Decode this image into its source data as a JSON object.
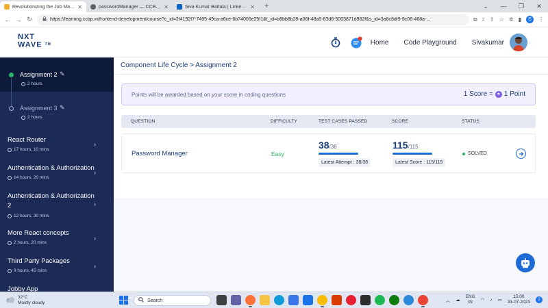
{
  "browser": {
    "tabs": [
      {
        "title": "Revolutionizing the Job Market |",
        "active": true,
        "color": "#f2b134"
      },
      {
        "title": "passwordManager — CCBP IDE",
        "active": false,
        "color": "#5f6368"
      },
      {
        "title": "Siva Kumar Battala | LinkedIn",
        "active": false,
        "color": "#0a66c2"
      }
    ],
    "new_tab": "+",
    "url": "https://learning.ccbp.in/frontend-development/course?c_id=2f4192f7-7495-49ca-a6ce-6b74005e25f1&t_id=b8bb8b28-a06f-48a5-83d6-5003871d882f&s_id=3a8c8df9-9c06-468a-...",
    "profile_initial": "S"
  },
  "header": {
    "logo_line1": "NXT",
    "logo_line2": "WAVE",
    "logo_tm": "TM",
    "nav_home": "Home",
    "nav_playground": "Code Playground",
    "user_name": "Sivakumar"
  },
  "sidebar": {
    "sub_items": [
      {
        "label": "Assignment 2",
        "time": "2 hours",
        "active": true
      },
      {
        "label": "Assignment 3",
        "time": "2 hours",
        "active": false
      }
    ],
    "items": [
      {
        "label": "React Router",
        "time": "17 hours, 10 mins"
      },
      {
        "label": "Authentication & Authorization",
        "time": "14 hours, 20 mins"
      },
      {
        "label": "Authentication & Authorization 2",
        "time": "12 hours, 30 mins"
      },
      {
        "label": "More React concepts",
        "time": "2 hours, 20 mins"
      },
      {
        "label": "Third Party Packages",
        "time": "9 hours, 45 mins"
      },
      {
        "label": "Jobby App",
        "time": ""
      }
    ]
  },
  "main": {
    "breadcrumb": "Component Life Cycle > Assignment 2",
    "notice": "Points will be awarded based on your score in coding questions",
    "score_prefix": "1 Score =",
    "score_suffix": "1 Point",
    "columns": {
      "question": "QUESTION",
      "difficulty": "DIFFICULTY",
      "test_cases": "TEST CASES PASSED",
      "score": "SCORE",
      "status": "STATUS"
    },
    "row": {
      "question": "Password Manager",
      "difficulty": "Easy",
      "tests_passed": "38",
      "tests_total": "/38",
      "latest_attempt": "Latest Attempt : 38/38",
      "score": "115",
      "score_total": "/115",
      "latest_score": "Latest Score : 115/115",
      "status": "SOLVED"
    }
  },
  "taskbar": {
    "temp": "32°C",
    "weather": "Mostly cloudy",
    "search": "Search",
    "lang1": "ENG",
    "lang2": "IN",
    "time": "15:00",
    "date": "31-07-2023",
    "notif_count": "2"
  },
  "colors": {
    "brand_navy": "#183b75",
    "sidebar_bg": "#1b2b55",
    "accent_blue": "#1f6bd6",
    "success_green": "#27b36a",
    "notice_bg": "#f2f0ff"
  }
}
